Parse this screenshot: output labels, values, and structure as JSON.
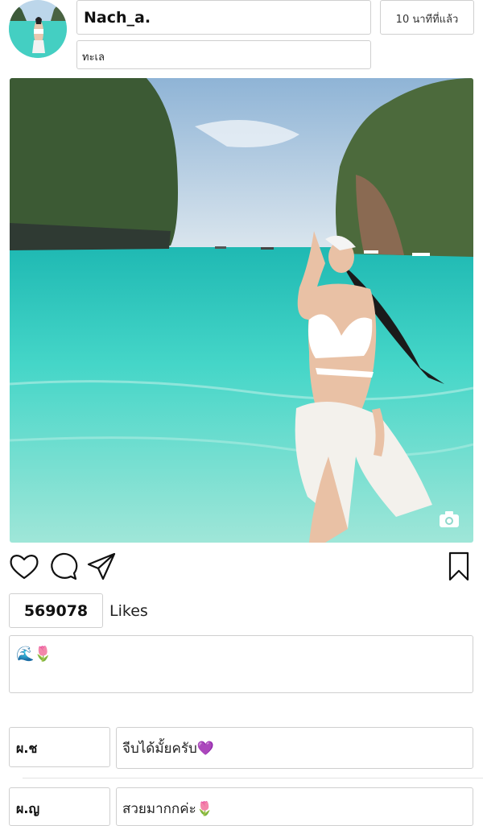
{
  "post": {
    "username": "Nach_a.",
    "time_ago": "10 นาทีที่แล้ว",
    "location": "ทะเล",
    "likes_count": "569078",
    "likes_label": "Likes",
    "caption": "🌊🌷"
  },
  "actions": {
    "icons": [
      "heart-icon",
      "comment-icon",
      "share-icon",
      "bookmark-icon",
      "camera-icon"
    ]
  },
  "comments": [
    {
      "user": "ผ.ช",
      "text": "จีบได้มั้ยครับ💜"
    },
    {
      "user": "ผ.ญ",
      "text": "สวยมากกค่ะ🌷"
    }
  ],
  "colors": {
    "sea": "#3fd3c6",
    "sky": "#b9d3ea",
    "border": "#cfcfcf"
  }
}
